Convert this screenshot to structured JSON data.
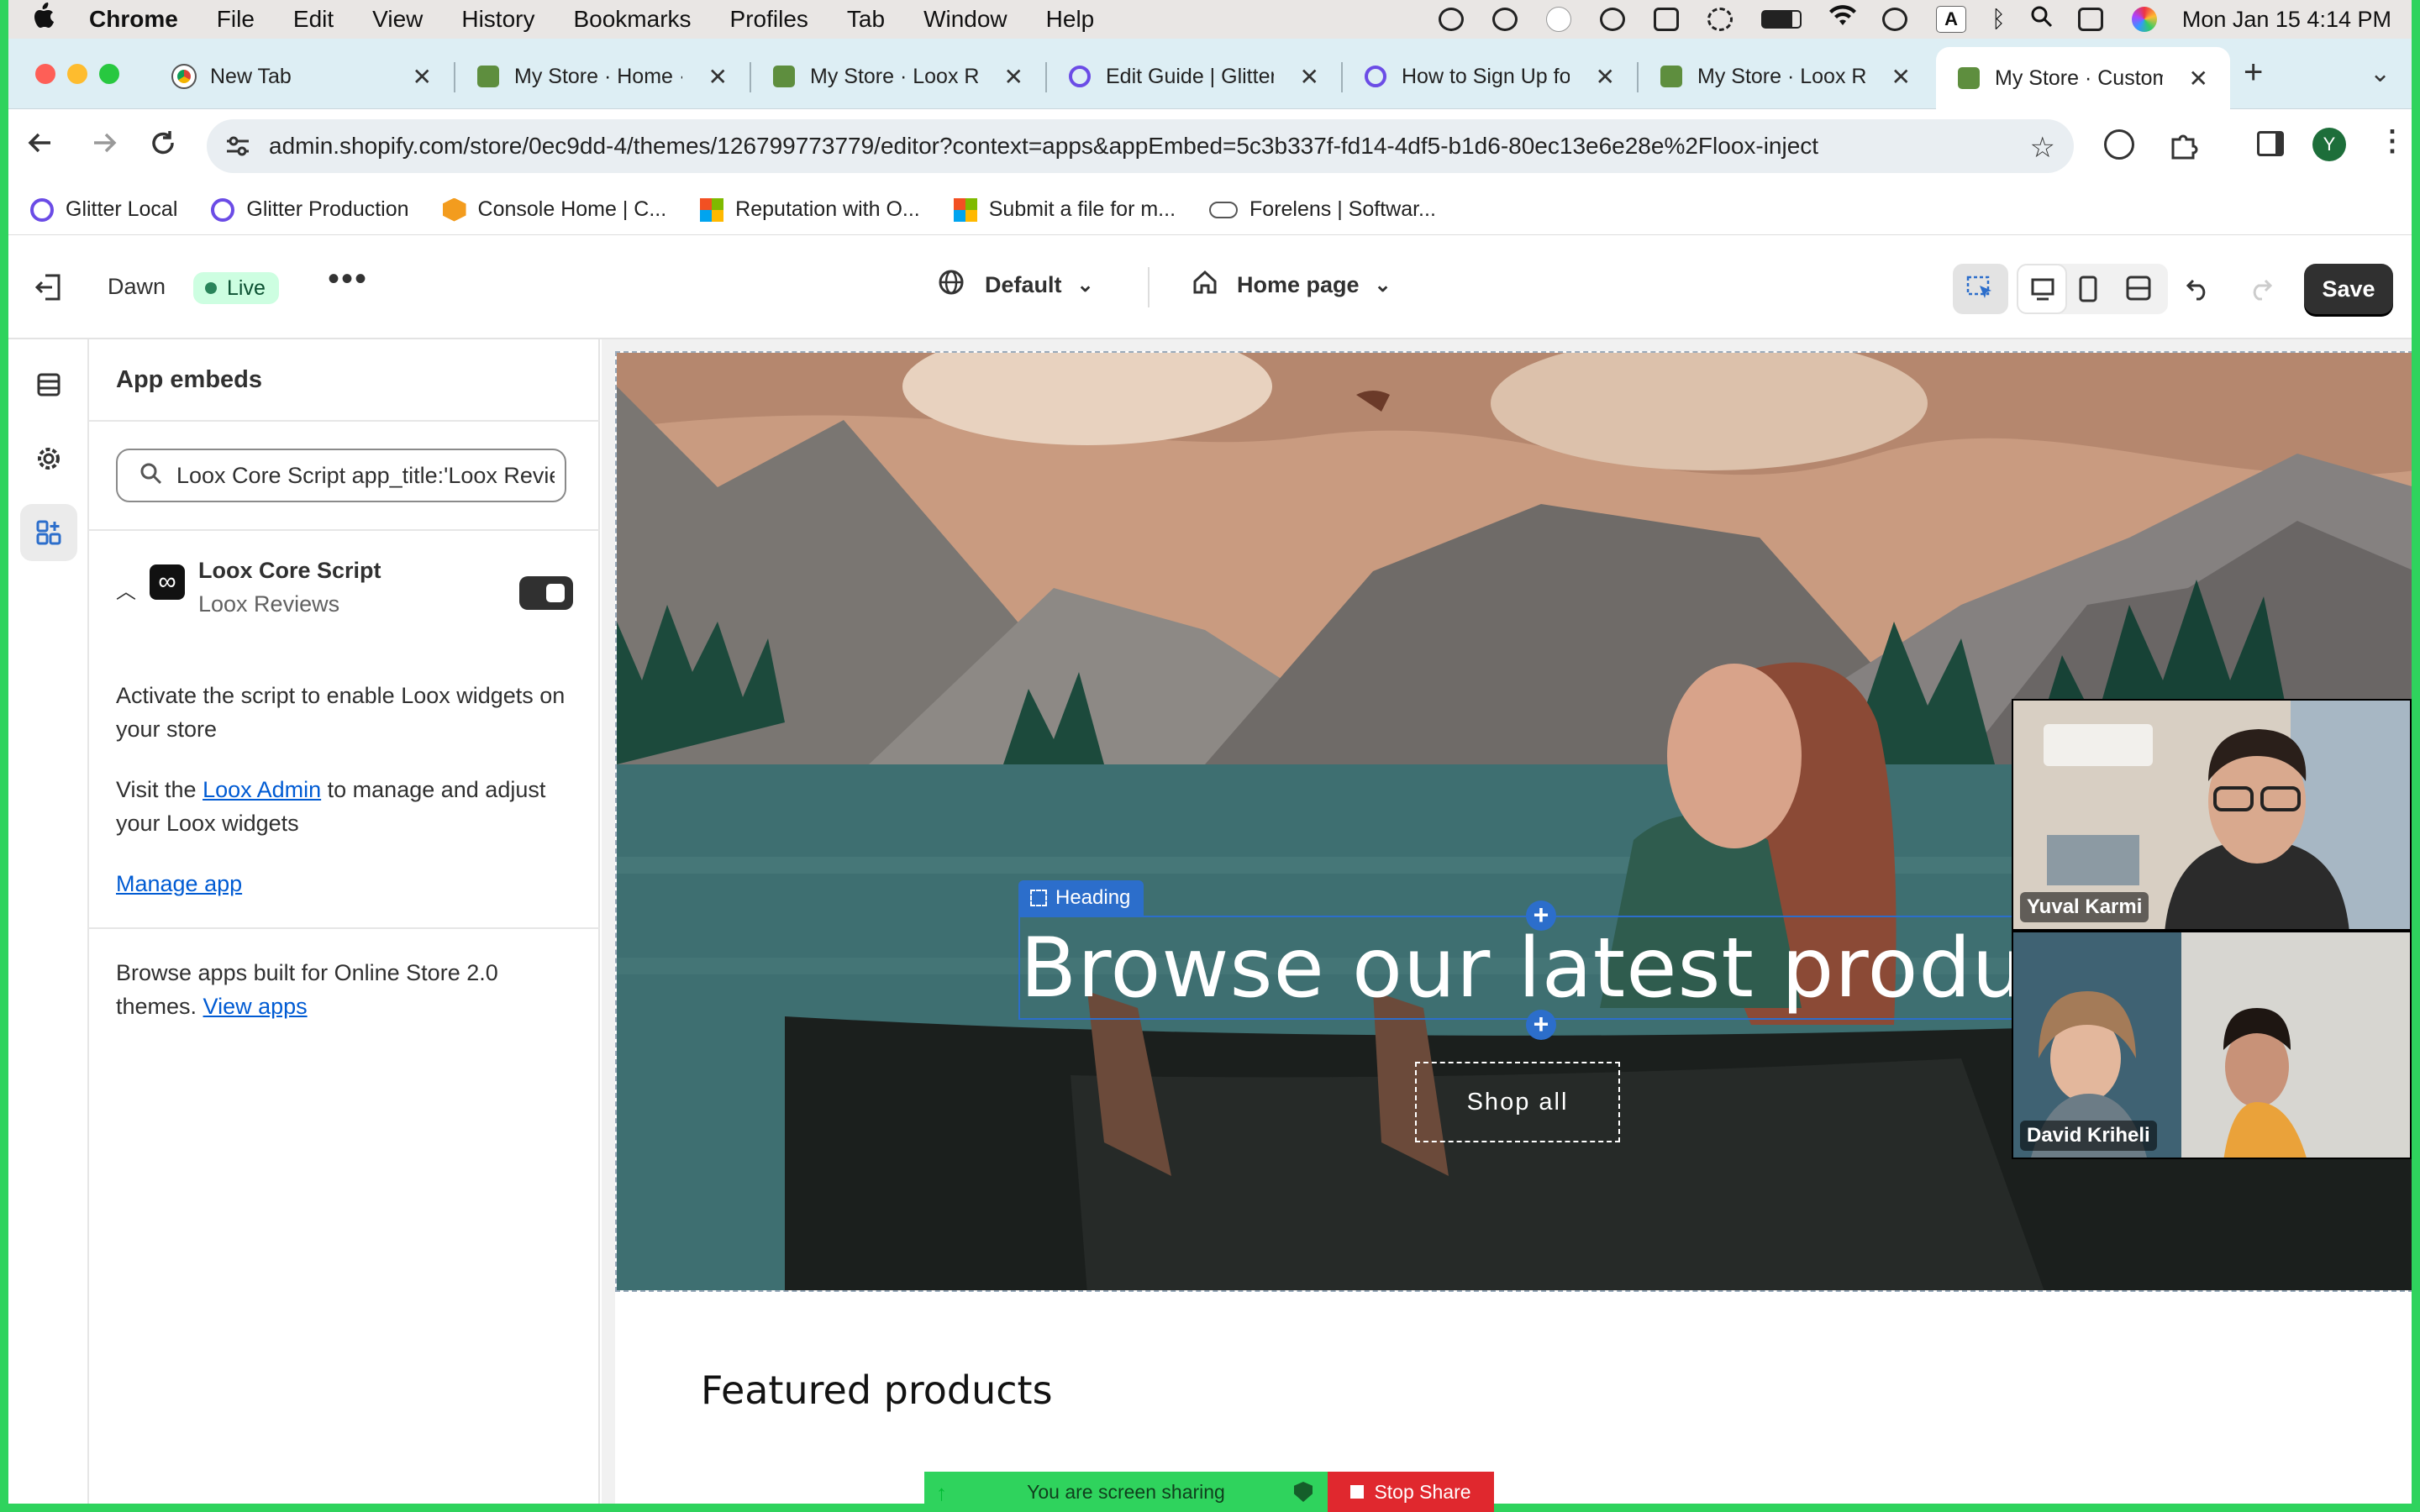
{
  "menubar": {
    "app": "Chrome",
    "items": [
      "File",
      "Edit",
      "View",
      "History",
      "Bookmarks",
      "Profiles",
      "Tab",
      "Window",
      "Help"
    ],
    "clock": "Mon Jan 15  4:14 PM",
    "input_badge": "A"
  },
  "tabs": [
    {
      "title": "New Tab",
      "favicon": "chrome-icon"
    },
    {
      "title": "My Store · Home ·",
      "favicon": "shopify-icon"
    },
    {
      "title": "My Store · Loox Re",
      "favicon": "shopify-icon"
    },
    {
      "title": "Edit Guide | Glitter",
      "favicon": "glitter-icon"
    },
    {
      "title": "How to Sign Up fo",
      "favicon": "glitter-icon"
    },
    {
      "title": "My Store · Loox Re",
      "favicon": "shopify-icon"
    },
    {
      "title": "My Store · Custom",
      "favicon": "shopify-icon",
      "active": true
    }
  ],
  "address": {
    "url": "admin.shopify.com/store/0ec9dd-4/themes/126799773779/editor?context=apps&appEmbed=5c3b337f-fd14-4df5-b1d6-80ec13e6e28e%2Floox-inject",
    "profile_initial": "Y"
  },
  "bookmarks": [
    {
      "label": "Glitter Local",
      "icon": "glitter-icon"
    },
    {
      "label": "Glitter Production",
      "icon": "glitter-icon"
    },
    {
      "label": "Console Home | C...",
      "icon": "cube-icon"
    },
    {
      "label": "Reputation with O...",
      "icon": "microsoft-icon"
    },
    {
      "label": "Submit a file for m...",
      "icon": "microsoft-icon"
    },
    {
      "label": "Forelens | Softwar...",
      "icon": "cloud-icon"
    }
  ],
  "editor": {
    "theme_name": "Dawn",
    "live_badge": "Live",
    "locale": "Default",
    "template": "Home page",
    "save_label": "Save"
  },
  "panel": {
    "title": "App embeds",
    "search_value": "Loox Core Script app_title:'Loox Reviews'",
    "app_name": "Loox Core Script",
    "app_vendor": "Loox Reviews",
    "description": "Activate the script to enable Loox widgets on your store",
    "visit_prefix": "Visit the ",
    "visit_link": "Loox Admin",
    "visit_suffix": " to manage and adjust your Loox widgets",
    "manage_link": "Manage app",
    "browse_text": "Browse apps built for Online Store 2.0 themes. ",
    "view_apps": "View apps"
  },
  "preview": {
    "heading_tag": "Heading",
    "heading": "Browse our latest products",
    "button": "Shop all",
    "featured": "Featured products"
  },
  "video": {
    "person1": "Yuval Karmi",
    "person2": "David Kriheli"
  },
  "share": {
    "status": "You are screen sharing",
    "stop": "Stop Share"
  },
  "colors": {
    "accent_blue": "#2c6ecb",
    "live_green": "#cdfee1",
    "share_green": "#2fd35d",
    "stop_red": "#e0282e"
  }
}
